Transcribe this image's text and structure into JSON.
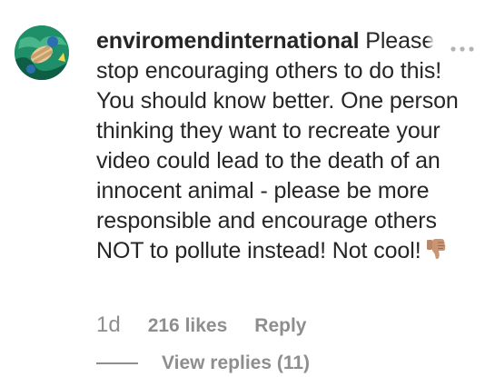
{
  "comment": {
    "username": "enviromendinternational",
    "text_lead": "Pleas",
    "text_faded": "e",
    "text_body": "stop encouraging others to do this! You should know better. One person thinking they want to recreate your video could lead to the death of an innocent animal - please be more responsible and encourage others NOT to pollute instead! Not cool!",
    "emoji": "thumbs-down-icon",
    "timestamp": "1d",
    "likes": "216 likes",
    "reply_label": "Reply",
    "view_replies": "View replies (11)"
  },
  "colors": {
    "text": "#262626",
    "muted": "#8e8e8e",
    "avatar": "#1f8f6a"
  },
  "icons": [
    "avatar",
    "more-options-icon",
    "thumbs-down-icon"
  ]
}
